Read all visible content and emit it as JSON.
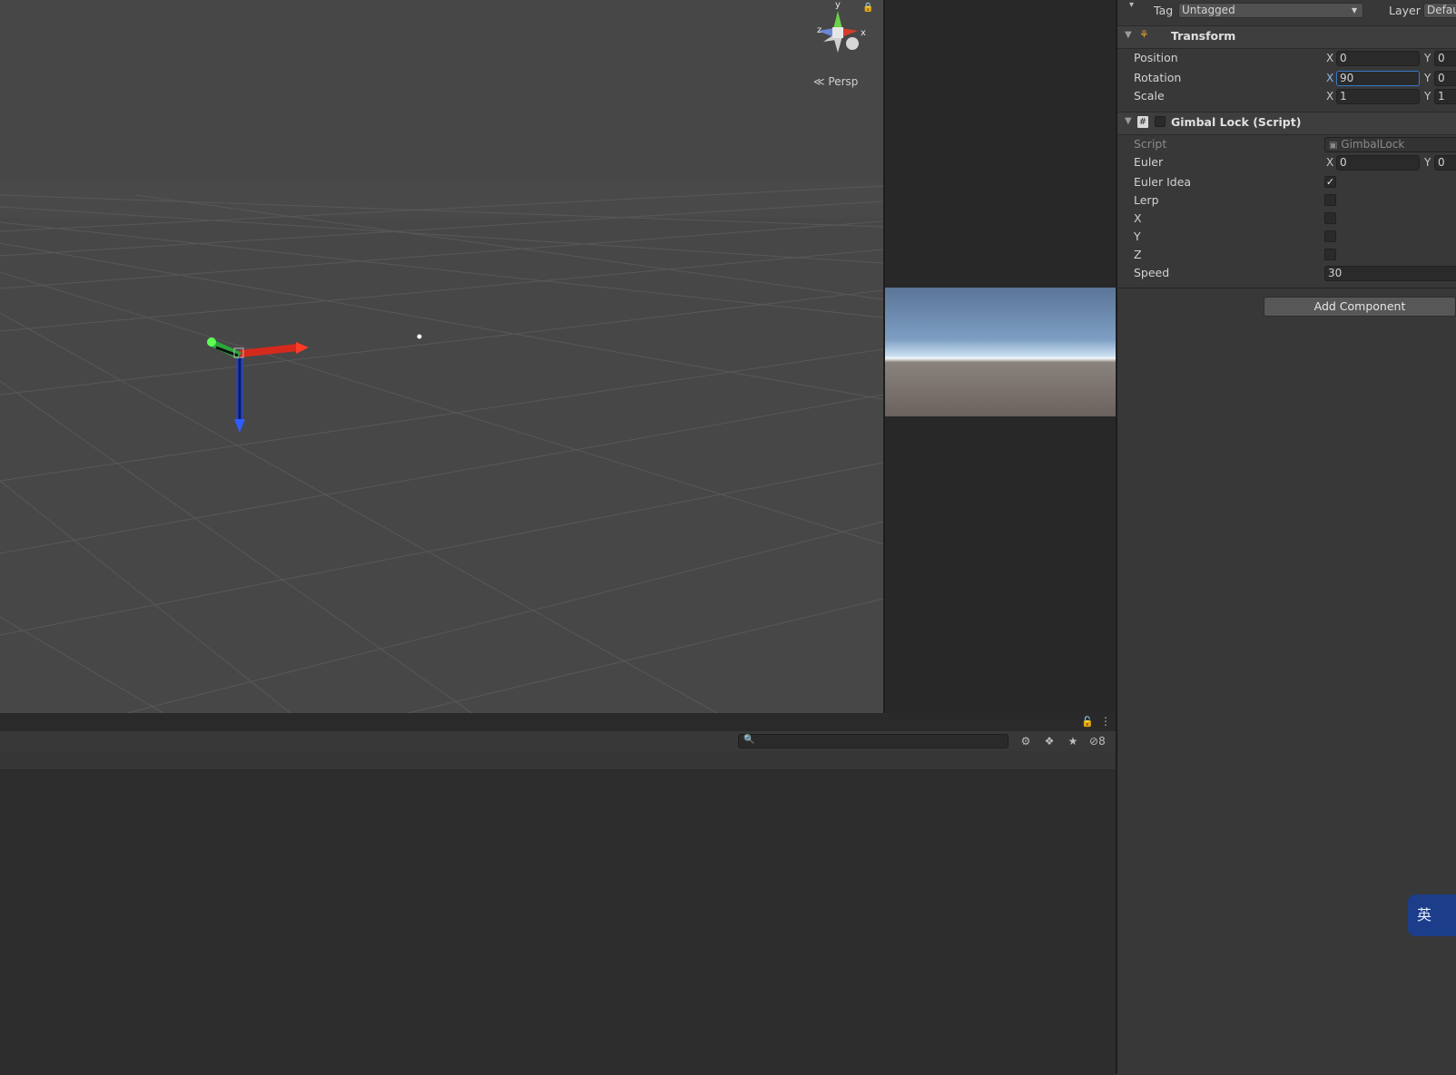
{
  "scene": {
    "projection_label": "Persp",
    "gizmo_axes": {
      "y": "y",
      "x": "x",
      "z": "z"
    }
  },
  "inspector": {
    "tag_label": "Tag",
    "tag_value": "Untagged",
    "layer_label": "Layer",
    "layer_value": "Defau",
    "transform": {
      "title": "Transform",
      "position": {
        "label": "Position",
        "x_label": "X",
        "x": "0",
        "y_label": "Y",
        "y": "0"
      },
      "rotation": {
        "label": "Rotation",
        "x_label": "X",
        "x": "90",
        "y_label": "Y",
        "y": "0"
      },
      "scale": {
        "label": "Scale",
        "x_label": "X",
        "x": "1",
        "y_label": "Y",
        "y": "1"
      }
    },
    "script_component": {
      "title": "Gimbal Lock (Script)",
      "script_label": "Script",
      "script_value": "GimbalLock",
      "euler": {
        "label": "Euler",
        "x_label": "X",
        "x": "0",
        "y_label": "Y",
        "y": "0"
      },
      "euler_idea": {
        "label": "Euler Idea",
        "checked": true
      },
      "lerp": {
        "label": "Lerp",
        "checked": false
      },
      "x_toggle": {
        "label": "X",
        "checked": false
      },
      "y_toggle": {
        "label": "Y",
        "checked": false
      },
      "z_toggle": {
        "label": "Z",
        "checked": false
      },
      "speed": {
        "label": "Speed",
        "value": "30"
      }
    },
    "add_component_label": "Add Component"
  },
  "project_panel": {
    "hidden_count": "8"
  },
  "ime": {
    "label": "英"
  }
}
